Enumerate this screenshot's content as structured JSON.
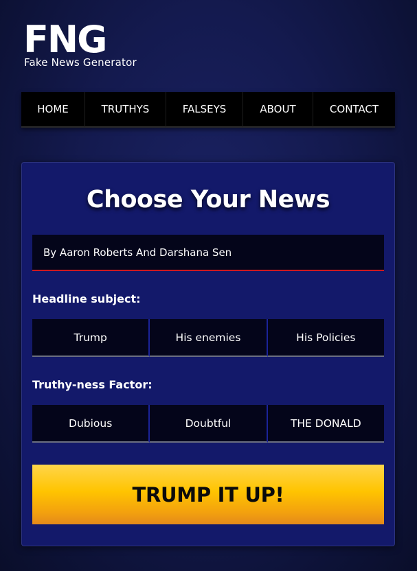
{
  "logo": {
    "mark": "FNG",
    "subtitle": "Fake News Generator"
  },
  "nav": {
    "items": [
      {
        "label": "HOME"
      },
      {
        "label": "TRUTHYS"
      },
      {
        "label": "FALSEYS"
      },
      {
        "label": "ABOUT"
      },
      {
        "label": "CONTACT"
      }
    ]
  },
  "main": {
    "title": "Choose Your News",
    "byline": "By Aaron Roberts And Darshana Sen",
    "headline_subject": {
      "label": "Headline subject:",
      "options": [
        "Trump",
        "His enemies",
        "His Policies"
      ]
    },
    "truthyness": {
      "label": "Truthy-ness Factor:",
      "options": [
        "Dubious",
        "Doubtful",
        "THE DONALD"
      ]
    },
    "cta_label": "TRUMP IT UP!"
  },
  "colors": {
    "background": "#141a4f",
    "card": "#13196a",
    "nav_bg": "#000000",
    "byline_underline": "#d0181e",
    "cta_top": "#ffd54a",
    "cta_bottom": "#e48a1a"
  }
}
